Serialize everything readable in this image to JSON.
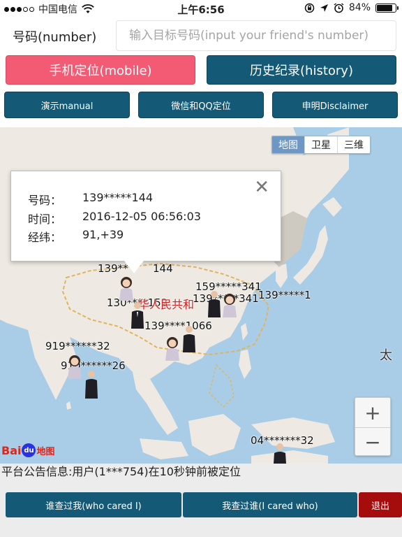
{
  "status_bar": {
    "carrier": "中国电信",
    "time": "上午6:56",
    "battery": "84%",
    "battery_level": 0.84
  },
  "number_row": {
    "label": "号码(number)",
    "placeholder": "输入目标号码(input your friend's number)"
  },
  "buttons": {
    "mobile": "手机定位(mobile)",
    "history": "历史纪录(history)",
    "manual": "演示manual",
    "wechat_qq": "微信和QQ定位",
    "disclaimer": "申明Disclaimer"
  },
  "map": {
    "map_types": [
      "地图",
      "卫星",
      "三维"
    ],
    "info": {
      "number_key": "号码：",
      "number_value": "139*****144",
      "time_key": "时间：",
      "time_value": "2016-12-05 06:56:03",
      "coord_key": "经纬：",
      "coord_value": "91,+39"
    },
    "labels": {
      "l1": "139**",
      "l1b": "144",
      "l2": "159*****341",
      "l3": "139*****341",
      "l4": "139*****1",
      "l5": "130****152",
      "l6": "139****1066",
      "l7": "919******32",
      "l8": "910******26",
      "l9": "04*******32",
      "china": "华人民共和",
      "pacific": "太"
    },
    "zoom_in": "+",
    "zoom_out": "−",
    "brand_a": "Bai",
    "brand_paw": "du",
    "brand_b": "地图"
  },
  "announcement": "平台公告信息:用户(1***754)在10秒钟前被定位",
  "bottom": {
    "cared_me": "谁查过我(who cared I)",
    "i_cared": "我查过谁(I cared who)",
    "exit": "退出"
  }
}
